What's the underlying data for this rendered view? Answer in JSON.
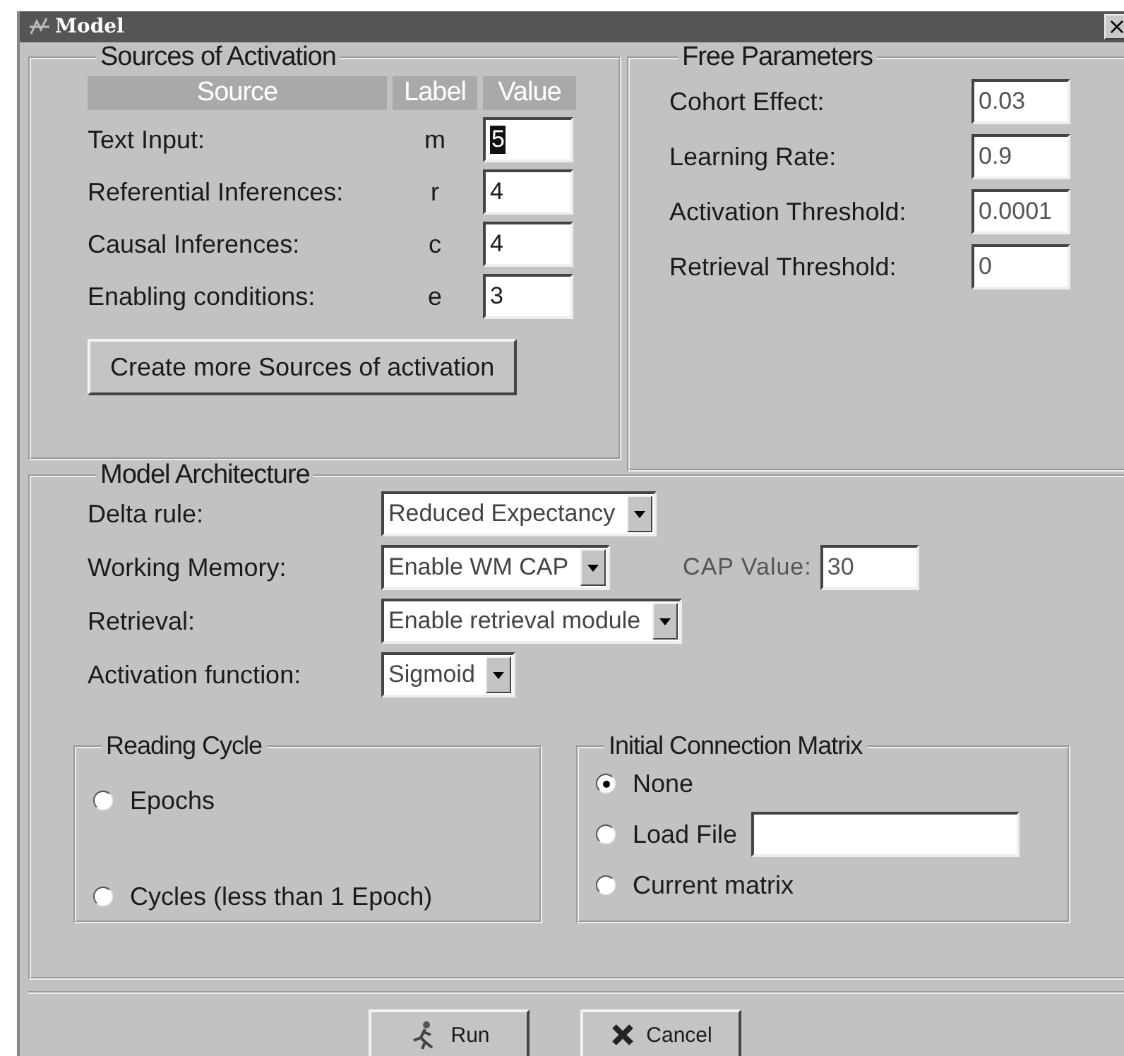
{
  "window": {
    "title": "Model",
    "close": "×"
  },
  "sources": {
    "title": "Sources of Activation",
    "columns": [
      "Source",
      "Label",
      "Value"
    ],
    "rows": [
      {
        "name": "Text Input:",
        "label": "m",
        "value": "5",
        "selected": true
      },
      {
        "name": "Referential Inferences:",
        "label": "r",
        "value": "4",
        "selected": false
      },
      {
        "name": "Causal Inferences:",
        "label": "c",
        "value": "4",
        "selected": false
      },
      {
        "name": "Enabling conditions:",
        "label": "e",
        "value": "3",
        "selected": false
      }
    ],
    "button": "Create more Sources of activation"
  },
  "free_parameters": {
    "title": "Free Parameters",
    "rows": [
      {
        "name": "Cohort Effect:",
        "value": "0.03"
      },
      {
        "name": "Learning Rate:",
        "value": "0.9"
      },
      {
        "name": "Activation Threshold:",
        "value": "0.0001"
      },
      {
        "name": "Retrieval Threshold:",
        "value": "0"
      }
    ]
  },
  "architecture": {
    "title": "Model Architecture",
    "rows": [
      {
        "label": "Delta rule:",
        "value": "Reduced Expectancy"
      },
      {
        "label": "Working Memory:",
        "value": "Enable WM CAP",
        "extra_label": "CAP Value:",
        "extra_value": "30"
      },
      {
        "label": "Retrieval:",
        "value": "Enable retrieval module"
      },
      {
        "label": "Activation function:",
        "value": "Sigmoid"
      }
    ]
  },
  "reading_cycle": {
    "title": "Reading Cycle",
    "options": [
      {
        "label": "Epochs",
        "selected": false
      },
      {
        "label": "Cycles (less than 1 Epoch)",
        "selected": false
      }
    ]
  },
  "initial_matrix": {
    "title": "Initial Connection Matrix",
    "options": [
      {
        "label": "None",
        "selected": true,
        "kind": "plain"
      },
      {
        "label": "Load File",
        "selected": false,
        "kind": "file"
      },
      {
        "label": "Current matrix",
        "selected": false,
        "kind": "plain"
      }
    ]
  },
  "buttons": [
    {
      "label": "Run",
      "kind": "run"
    },
    {
      "label": "Cancel",
      "kind": "cancel"
    }
  ]
}
